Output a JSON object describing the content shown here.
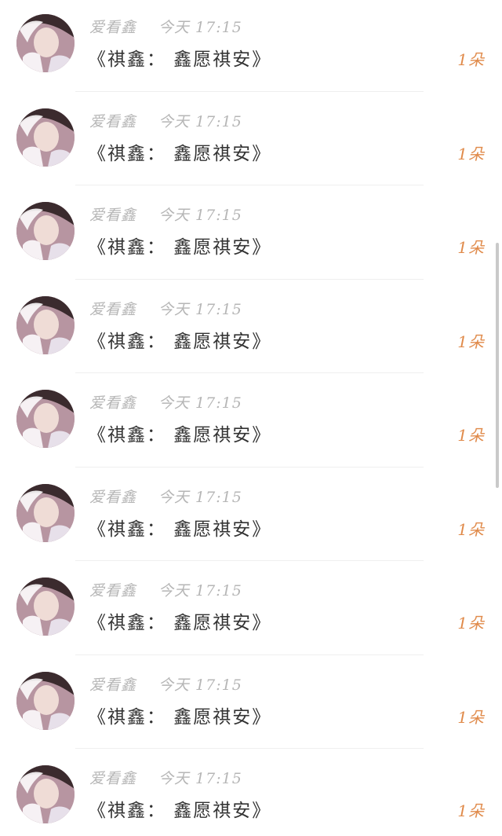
{
  "messages": [
    {
      "sender": "爱看鑫",
      "time": "今天 17:15",
      "text": "《祺鑫： 鑫愿祺安》",
      "count": "1朵"
    },
    {
      "sender": "爱看鑫",
      "time": "今天 17:15",
      "text": "《祺鑫： 鑫愿祺安》",
      "count": "1朵"
    },
    {
      "sender": "爱看鑫",
      "time": "今天 17:15",
      "text": "《祺鑫： 鑫愿祺安》",
      "count": "1朵"
    },
    {
      "sender": "爱看鑫",
      "time": "今天 17:15",
      "text": "《祺鑫： 鑫愿祺安》",
      "count": "1朵"
    },
    {
      "sender": "爱看鑫",
      "time": "今天 17:15",
      "text": "《祺鑫： 鑫愿祺安》",
      "count": "1朵"
    },
    {
      "sender": "爱看鑫",
      "time": "今天 17:15",
      "text": "《祺鑫： 鑫愿祺安》",
      "count": "1朵"
    },
    {
      "sender": "爱看鑫",
      "time": "今天 17:15",
      "text": "《祺鑫： 鑫愿祺安》",
      "count": "1朵"
    },
    {
      "sender": "爱看鑫",
      "time": "今天 17:15",
      "text": "《祺鑫： 鑫愿祺安》",
      "count": "1朵"
    },
    {
      "sender": "爱看鑫",
      "time": "今天 17:15",
      "text": "《祺鑫： 鑫愿祺安》",
      "count": "1朵"
    }
  ],
  "colors": {
    "meta_text": "#b6b6b6",
    "message_text": "#333333",
    "count_text": "#e08a4a",
    "divider": "#efefef",
    "scrollbar": "#c9c9c9"
  },
  "icons": {
    "avatar": "user-avatar-photo"
  }
}
